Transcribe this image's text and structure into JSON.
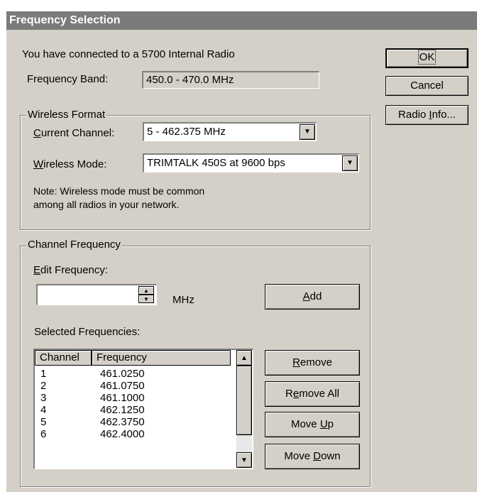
{
  "window": {
    "title": "Frequency Selection"
  },
  "info": {
    "connected_text": "You have connected to a 5700 Internal Radio",
    "band_label": "Frequency Band:",
    "band_value": "450.0 - 470.0 MHz"
  },
  "buttons": {
    "ok": "OK",
    "cancel": "Cancel",
    "radio_info_pre": "Radio ",
    "radio_info_u": "I",
    "radio_info_post": "nfo..."
  },
  "wireless_format": {
    "legend": "Wireless Format",
    "channel_label_u": "C",
    "channel_label_rest": "urrent Channel:",
    "channel_value": "5 - 462.375 MHz",
    "mode_label_u": "W",
    "mode_label_rest": "ireless Mode:",
    "mode_value": "TRIMTALK 450S at 9600 bps",
    "note_line1": "Note: Wireless mode must be common",
    "note_line2": "among all radios in your network."
  },
  "channel_frequency": {
    "legend": "Channel Frequency",
    "edit_label_u": "E",
    "edit_label_rest": "dit Frequency:",
    "edit_value": "",
    "unit": "MHz",
    "add_u": "A",
    "add_rest": "dd",
    "selected_label": "Selected Frequencies:",
    "columns": [
      "Channel",
      "Frequency"
    ],
    "rows": [
      {
        "channel": "1",
        "frequency": "461.0250"
      },
      {
        "channel": "2",
        "frequency": "461.0750"
      },
      {
        "channel": "3",
        "frequency": "461.1000"
      },
      {
        "channel": "4",
        "frequency": "462.1250"
      },
      {
        "channel": "5",
        "frequency": "462.3750"
      },
      {
        "channel": "6",
        "frequency": "462.4000"
      }
    ],
    "remove_u": "R",
    "remove_rest": "emove",
    "remove_all_pre": "R",
    "remove_all_u": "e",
    "remove_all_post": "move All",
    "move_up_pre": "Move ",
    "move_up_u": "U",
    "move_up_post": "p",
    "move_down_pre": "Move ",
    "move_down_u": "D",
    "move_down_post": "own"
  },
  "icons": {
    "dropdown": "triangle-down",
    "scroll_up": "triangle-up",
    "scroll_down": "triangle-down",
    "spin": "up-down-arrows"
  }
}
